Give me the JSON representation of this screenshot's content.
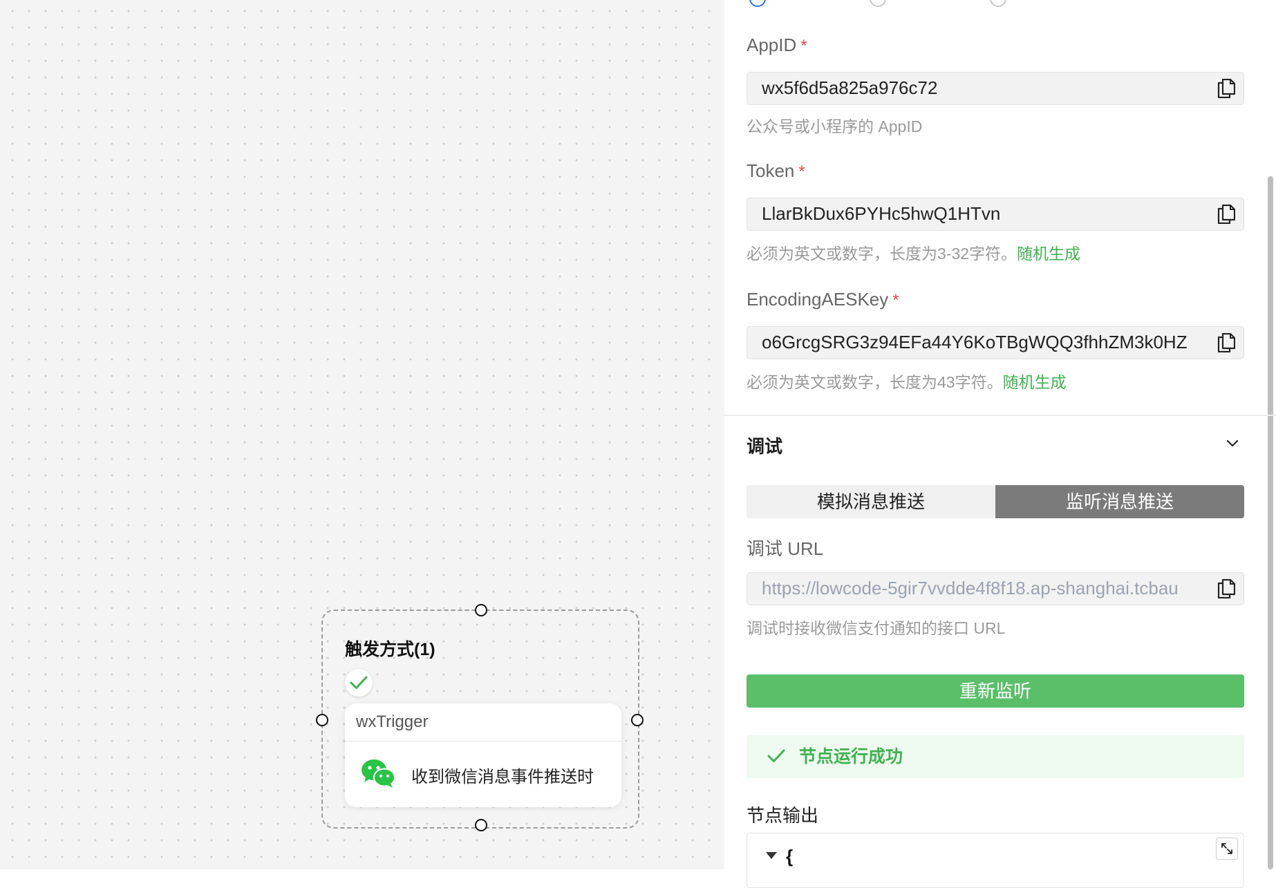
{
  "canvas": {
    "group_title": "触发方式(1)",
    "node": {
      "name": "wxTrigger",
      "description": "收到微信消息事件推送时",
      "icon": "wechat-icon",
      "status_icon": "check-icon"
    }
  },
  "panel": {
    "appid": {
      "label": "AppID",
      "required_mark": "*",
      "value": "wx5f6d5a825a976c72",
      "hint": "公众号或小程序的 AppID"
    },
    "token": {
      "label": "Token",
      "required_mark": "*",
      "value": "LlarBkDux6PYHc5hwQ1HTvn",
      "hint": "必须为英文或数字，长度为3-32字符。",
      "hint_link": "随机生成"
    },
    "aeskey": {
      "label": "EncodingAESKey",
      "required_mark": "*",
      "value": "o6GrcgSRG3z94EFa44Y6KoTBgWQQ3fhhZM3k0HZ",
      "hint": "必须为英文或数字，长度为43字符。",
      "hint_link": "随机生成"
    },
    "debug": {
      "section_title": "调试",
      "tabs": [
        "模拟消息推送",
        "监听消息推送"
      ],
      "active_tab": 1,
      "url_label": "调试 URL",
      "url_value": "https://lowcode-5gir7vvdde4f8f18.ap-shanghai.tcbau",
      "url_hint": "调试时接收微信支付通知的接口 URL",
      "relisten_button": "重新监听",
      "success_text": "节点运行成功",
      "output_label": "节点输出",
      "output_json_open": "{"
    },
    "colors": {
      "accent_green": "#5bbf6a",
      "link_green": "#3fb24f",
      "required_red": "#e5484d",
      "active_tab_gray": "#7b7b7b"
    }
  }
}
